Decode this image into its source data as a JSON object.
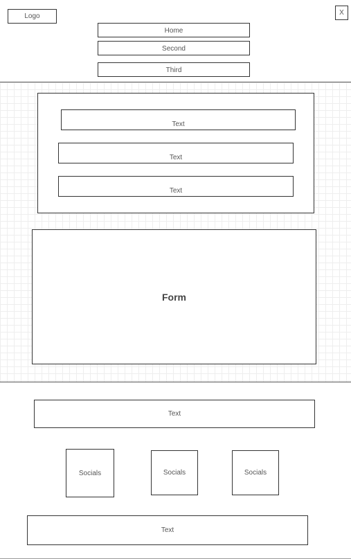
{
  "header": {
    "logo": "Logo",
    "close": "X",
    "nav": [
      "Home",
      "Second",
      "Third"
    ]
  },
  "main": {
    "text_items": [
      "Text",
      "Text",
      "Text"
    ],
    "form_label": "Form"
  },
  "footer": {
    "text_top": "Text",
    "socials": [
      "Socials",
      "Socials",
      "Socials"
    ],
    "text_bottom": "Text"
  }
}
